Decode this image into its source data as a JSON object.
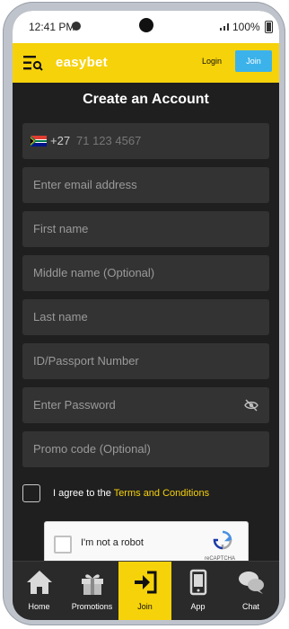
{
  "statusbar": {
    "time": "12:41 PM",
    "battery": "100%"
  },
  "appbar": {
    "logo_easy": "easy",
    "logo_bet": "bet",
    "login_label": "Login",
    "join_label": "Join",
    "brand_color": "#f6d20a",
    "join_color": "#3bb3ea"
  },
  "form": {
    "title": "Create an Account",
    "country_code": "+27",
    "phone_placeholder": "71 123 4567",
    "email_placeholder": "Enter email address",
    "first_name_placeholder": "First name",
    "middle_name_placeholder": "Middle name (Optional)",
    "last_name_placeholder": "Last name",
    "id_placeholder": "ID/Passport Number",
    "password_placeholder": "Enter Password",
    "promo_placeholder": "Promo code (Optional)",
    "agree_text": "I agree to the ",
    "terms_link": "Terms and Conditions"
  },
  "recaptcha": {
    "label": "I'm not a robot",
    "brand": "reCAPTCHA"
  },
  "bottom_nav": {
    "items": [
      {
        "label": "Home",
        "icon": "home-icon"
      },
      {
        "label": "Promotions",
        "icon": "gift-icon"
      },
      {
        "label": "Join",
        "icon": "sign-in-icon",
        "active": true
      },
      {
        "label": "App",
        "icon": "phone-icon"
      },
      {
        "label": "Chat",
        "icon": "chat-icon"
      }
    ]
  }
}
